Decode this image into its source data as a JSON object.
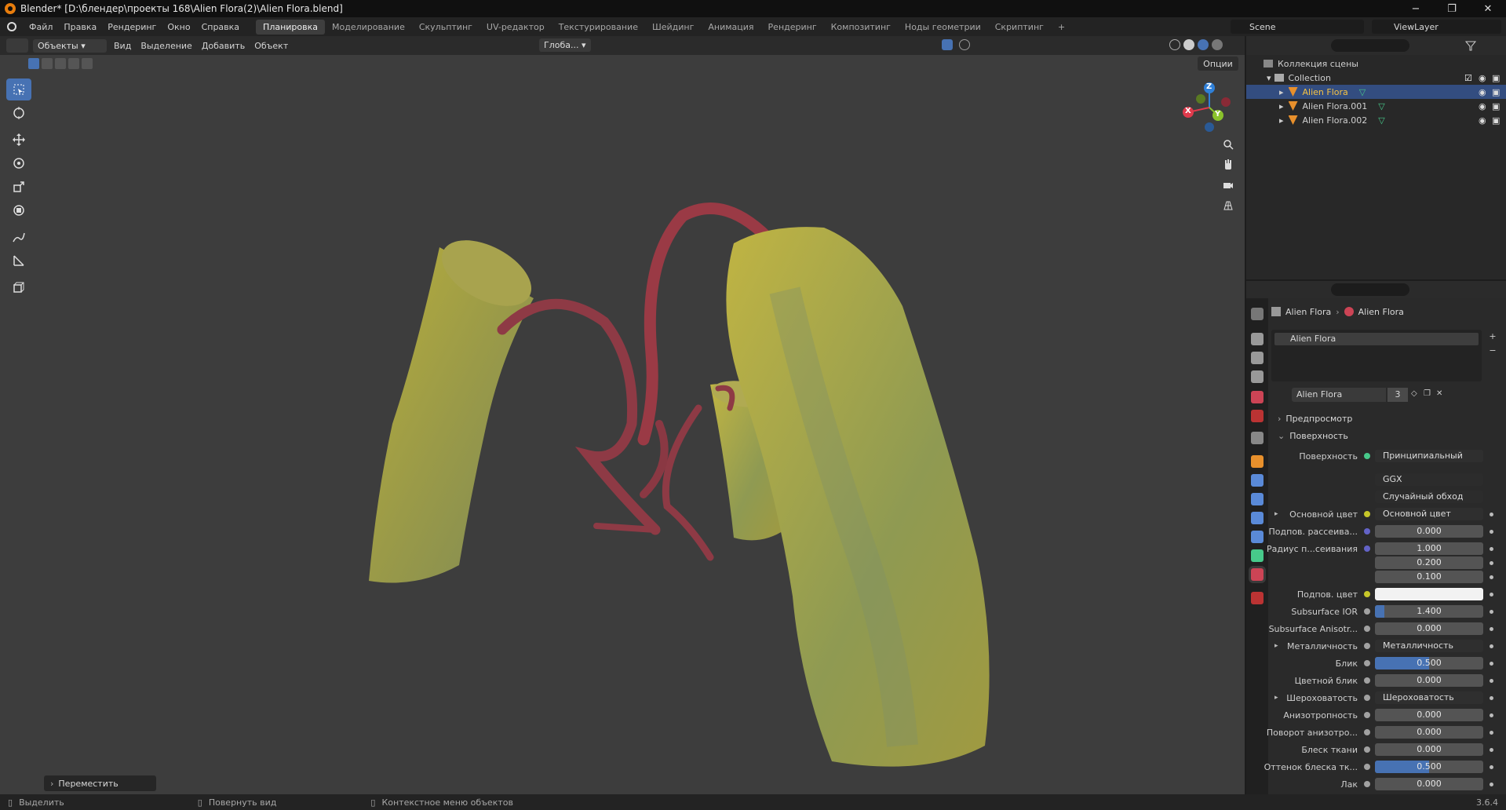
{
  "window": {
    "title": "Blender* [D:\\блендер\\проекты 168\\Alien Flora(2)\\Alien Flora.blend]",
    "min": "−",
    "max": "❐",
    "close": "✕"
  },
  "menubar": {
    "items": [
      "Файл",
      "Правка",
      "Рендеринг",
      "Окно",
      "Справка"
    ],
    "workspaces": [
      "Планировка",
      "Моделирование",
      "Скульптинг",
      "UV-редактор",
      "Текстурирование",
      "Шейдинг",
      "Анимация",
      "Рендеринг",
      "Композитинг",
      "Ноды геометрии",
      "Скриптинг"
    ],
    "active_workspace": "Планировка",
    "add_ws": "+",
    "scene": "Scene",
    "view_layer": "ViewLayer"
  },
  "viewport_header": {
    "mode": "Объекты",
    "menus": [
      "Вид",
      "Выделение",
      "Добавить",
      "Объект"
    ],
    "transform": "Глоба...",
    "options": "Опции"
  },
  "operator_panel": {
    "label": "Переместить"
  },
  "gizmo": {
    "x": "X",
    "y": "Y",
    "z": "Z"
  },
  "outliner": {
    "scene_collection": "Коллекция сцены",
    "collection": "Collection",
    "objects": [
      "Alien Flora",
      "Alien Flora.001",
      "Alien Flora.002"
    ],
    "selected": "Alien Flora"
  },
  "properties": {
    "breadcrumb": {
      "object": "Alien Flora",
      "material": "Alien Flora"
    },
    "slot": "Alien Flora",
    "material_name": "Alien Flora",
    "users": "3",
    "sections": {
      "preview": "Предпросмотр",
      "surface": "Поверхность"
    },
    "surface": {
      "label": "Поверхность",
      "value": "Принципиальный BSDF"
    },
    "distribution": "GGX",
    "subsurface_method": "Случайный обход",
    "rows": [
      {
        "label": "Основной цвет",
        "value": "Основной цвет",
        "type": "link",
        "dot": "#c7c729",
        "expand": true
      },
      {
        "label": "Подпов. рассеива...",
        "value": "0.000",
        "type": "num",
        "dot": "#6363c7",
        "fill": 0
      },
      {
        "label": "Радиус п...сеивания",
        "value": "1.000",
        "type": "num",
        "dot": "#6363c7",
        "fill": 0
      },
      {
        "label": "",
        "value": "0.200",
        "type": "num",
        "dot": "",
        "fill": 0
      },
      {
        "label": "",
        "value": "0.100",
        "type": "num",
        "dot": "",
        "fill": 0
      },
      {
        "label": "Подпов. цвет",
        "value": "",
        "type": "color",
        "dot": "#c7c729",
        "swatch": "#f2f2f2"
      },
      {
        "label": "Subsurface IOR",
        "value": "1.400",
        "type": "num",
        "dot": "#a1a1a1",
        "fill": 0.09
      },
      {
        "label": "Subsurface Anisotr...",
        "value": "0.000",
        "type": "num",
        "dot": "#a1a1a1",
        "fill": 0
      },
      {
        "label": "Металличность",
        "value": "Металличность",
        "type": "link",
        "dot": "#a1a1a1",
        "expand": true
      },
      {
        "label": "Блик",
        "value": "0.500",
        "type": "num",
        "dot": "#a1a1a1",
        "fill": 0.5
      },
      {
        "label": "Цветной блик",
        "value": "0.000",
        "type": "num",
        "dot": "#a1a1a1",
        "fill": 0
      },
      {
        "label": "Шероховатость",
        "value": "Шероховатость",
        "type": "link",
        "dot": "#a1a1a1",
        "expand": true
      },
      {
        "label": "Анизотропность",
        "value": "0.000",
        "type": "num",
        "dot": "#a1a1a1",
        "fill": 0
      },
      {
        "label": "Поворот анизотро...",
        "value": "0.000",
        "type": "num",
        "dot": "#a1a1a1",
        "fill": 0
      },
      {
        "label": "Блеск ткани",
        "value": "0.000",
        "type": "num",
        "dot": "#a1a1a1",
        "fill": 0
      },
      {
        "label": "Оттенок блеска тк...",
        "value": "0.500",
        "type": "num",
        "dot": "#a1a1a1",
        "fill": 0.5
      },
      {
        "label": "Лак",
        "value": "0.000",
        "type": "num",
        "dot": "#a1a1a1",
        "fill": 0
      }
    ]
  },
  "statusbar": {
    "select": "Выделить",
    "rotate": "Повернуть вид",
    "context": "Контекстное меню объектов",
    "version": "3.6.4"
  }
}
